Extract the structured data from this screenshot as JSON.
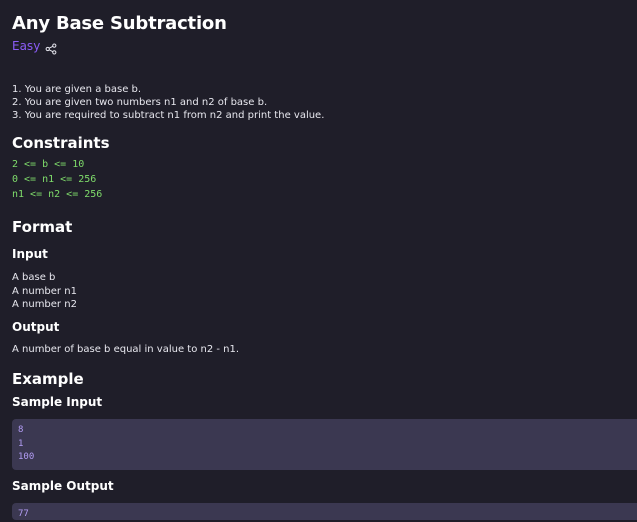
{
  "problem": {
    "title": "Any Base Subtraction",
    "difficulty": "Easy",
    "share_icon": "share-icon",
    "description": [
      "1. You are given a base b.",
      "2. You are given two numbers n1 and n2 of base b.",
      "3. You are required to subtract n1 from n2 and print the value."
    ]
  },
  "constraints": {
    "heading": "Constraints",
    "lines": [
      "2 <= b <= 10",
      "0 <= n1 <= 256",
      "n1 <= n2 <= 256"
    ]
  },
  "format": {
    "heading": "Format",
    "input_heading": "Input",
    "input_lines": [
      "A base b",
      "A number n1",
      "A number n2"
    ],
    "output_heading": "Output",
    "output_lines": [
      "A number of base b equal in value to n2 - n1."
    ]
  },
  "example": {
    "heading": "Example",
    "sample_input_heading": "Sample Input",
    "sample_input_lines": [
      "8",
      "1",
      "100"
    ],
    "sample_output_heading": "Sample Output",
    "sample_output_lines": [
      "77"
    ]
  },
  "colors": {
    "background": "#1f1e29",
    "accent": "#8b5cf6",
    "constraint_text": "#7fdc6b",
    "code_background": "#3b3851",
    "code_text": "#b39df5"
  }
}
